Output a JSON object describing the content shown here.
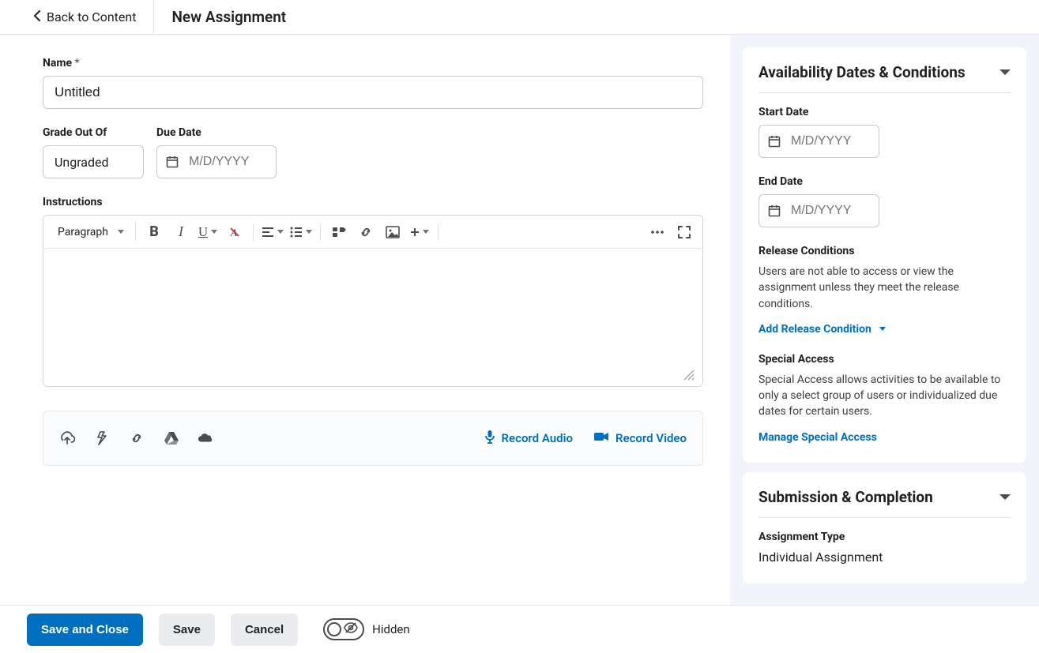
{
  "header": {
    "back_label": "Back to Content",
    "title": "New Assignment"
  },
  "main": {
    "name_label": "Name",
    "name_required": "*",
    "name_value": "Untitled",
    "grade_label": "Grade Out Of",
    "grade_value": "Ungraded",
    "due_date_label": "Due Date",
    "due_date_placeholder": "M/D/YYYY",
    "instructions_label": "Instructions",
    "editor": {
      "block_format": "Paragraph"
    },
    "attach": {
      "record_audio_label": "Record Audio",
      "record_video_label": "Record Video"
    }
  },
  "side": {
    "availability": {
      "title": "Availability Dates & Conditions",
      "start_label": "Start Date",
      "start_placeholder": "M/D/YYYY",
      "end_label": "End Date",
      "end_placeholder": "M/D/YYYY",
      "release_title": "Release Conditions",
      "release_text": "Users are not able to access or view the assignment unless they meet the release conditions.",
      "add_release_label": "Add Release Condition",
      "special_title": "Special Access",
      "special_text": "Special Access allows activities to be available to only a select group of users or individualized due dates for certain users.",
      "manage_special_label": "Manage Special Access"
    },
    "submission": {
      "title": "Submission & Completion",
      "type_label": "Assignment Type",
      "type_value": "Individual Assignment"
    }
  },
  "footer": {
    "save_close": "Save and Close",
    "save": "Save",
    "cancel": "Cancel",
    "visibility_label": "Hidden"
  }
}
